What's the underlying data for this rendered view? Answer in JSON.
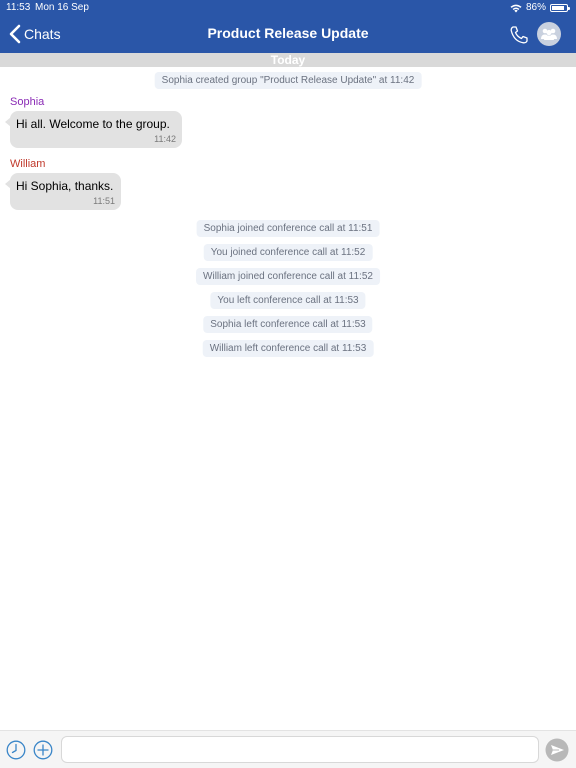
{
  "status_bar": {
    "time": "11:53",
    "date": "Mon 16 Sep",
    "battery": "86%",
    "battery_level": 0.86
  },
  "nav": {
    "back_label": "Chats",
    "title": "Product Release Update",
    "call_icon": "phone-icon",
    "avatar_icon": "group-icon"
  },
  "date_divider": "Today",
  "colors": {
    "header": "#2a56a8",
    "sophia": "#8a2bb5",
    "william": "#c0392b",
    "icons": "#3a86c8"
  },
  "system_created": "Sophia created group \"Product Release Update\" at 11:42",
  "messages": [
    {
      "sender": "Sophia",
      "text": "Hi all. Welcome to the group.",
      "time": "11:42"
    },
    {
      "sender": "William",
      "text": "Hi Sophia, thanks.",
      "time": "11:51"
    }
  ],
  "events": [
    "Sophia joined conference call at 11:51",
    "You joined conference call at 11:52",
    "William joined conference call at 11:52",
    "You left conference call at 11:53",
    "Sophia left conference call at 11:53",
    "William left conference call at 11:53"
  ],
  "input": {
    "placeholder": "",
    "value": ""
  }
}
